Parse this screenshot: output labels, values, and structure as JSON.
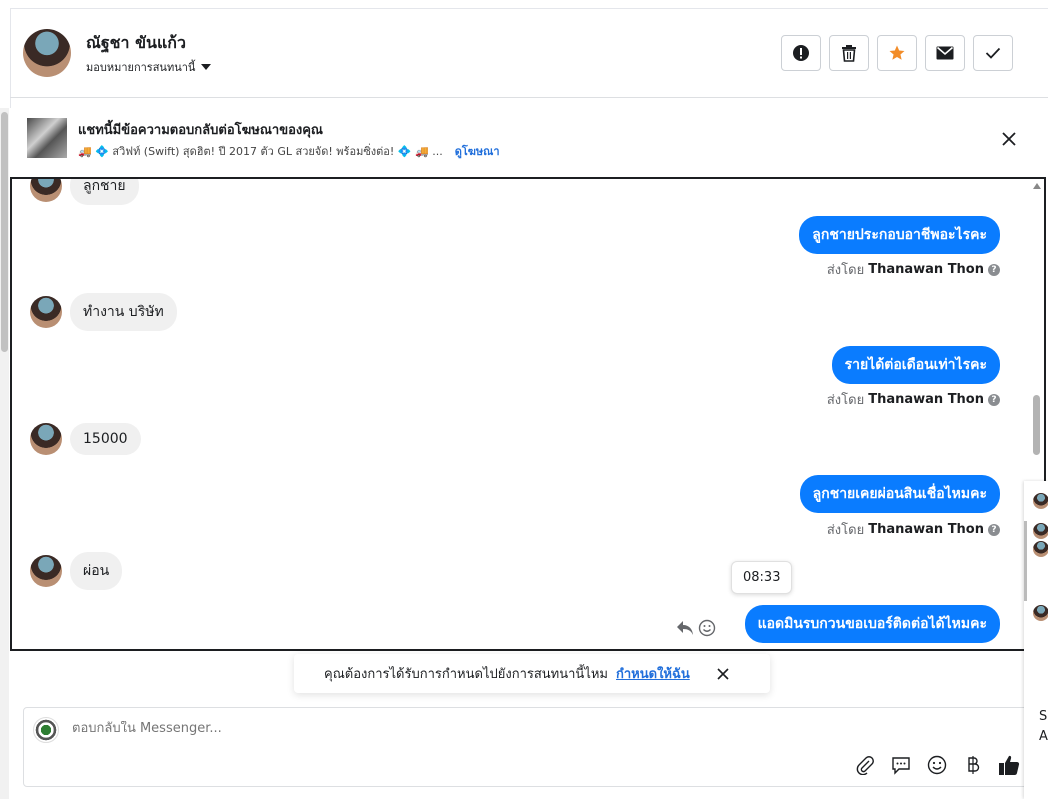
{
  "header": {
    "name": "ณัฐชา ขันแก้ว",
    "assign_label": "มอบหมายการสนทนานี้",
    "actions": [
      {
        "icon": "alert-icon"
      },
      {
        "icon": "trash-icon"
      },
      {
        "icon": "star-icon",
        "color": "#f28c28"
      },
      {
        "icon": "mail-icon"
      },
      {
        "icon": "check-icon"
      }
    ]
  },
  "ad_banner": {
    "title": "แชทนี้มีข้อความตอบกลับต่อโฆษณาของคุณ",
    "subtitle": "🚚 💠 สวิฟท์ (Swift) สุดฮิต! ปี 2017 ตัว GL สวยจัด! พร้อมซิ่งต่อ! 💠 🚚 ...",
    "link": "ดูโฆษณา"
  },
  "chat": {
    "partial_top": "ลูกชาย",
    "messages": [
      {
        "dir": "out",
        "text": "ลูกชายประกอบอาชีพอะไรคะ",
        "sent_by_label": "ส่งโดย",
        "sender": "Thanawan Thon"
      },
      {
        "dir": "in",
        "text": "ทำงาน บริษัท"
      },
      {
        "dir": "out",
        "text": "รายได้ต่อเดือนเท่าไรคะ",
        "sent_by_label": "ส่งโดย",
        "sender": "Thanawan Thon"
      },
      {
        "dir": "in",
        "text": "15000"
      },
      {
        "dir": "out",
        "text": "ลูกชายเคยผ่อนสินเชื่อไหมคะ",
        "sent_by_label": "ส่งโดย",
        "sender": "Thanawan Thon"
      },
      {
        "dir": "in",
        "text": "ผ่อน"
      },
      {
        "dir": "out",
        "text": "แอดมินรบกวนขอเบอร์ติดต่อได้ไหมคะ"
      }
    ],
    "tooltip_time": "08:33",
    "accent_color": "#0a7cff"
  },
  "notice": {
    "text": "คุณต้องการได้รับการกำหนดไปยังการสนทนานี้ไหม",
    "link": "กำหนดให้ฉัน"
  },
  "composer": {
    "placeholder": "ตอบกลับใน Messenger...",
    "tools": [
      "attach-icon",
      "saved-replies-icon",
      "emoji-icon",
      "baht-icon",
      "like-icon"
    ]
  },
  "edge_panel": {
    "letters": [
      "S",
      "A"
    ]
  }
}
